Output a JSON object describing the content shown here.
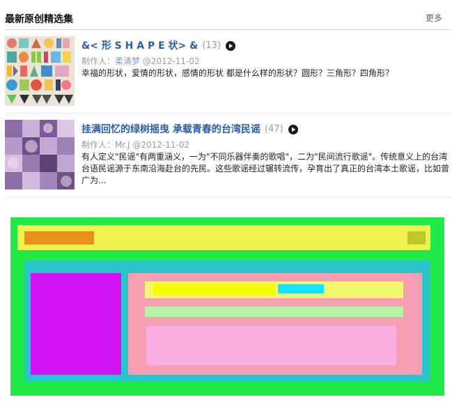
{
  "header": {
    "title": "最新原创精选集",
    "more_label": "更多"
  },
  "items": [
    {
      "title": "&< 形 S H A P E 状> &",
      "count": "(13)",
      "meta_prefix": "制作人：",
      "author": "柔清梦",
      "date": "@2012-11-02",
      "description": "幸福的形状，爱情的形状，感情的形状 都是什么样的形状？圆形？三角形？四角形？",
      "thumb": "alphabet-letters-image"
    },
    {
      "title": "挂满回忆的绿树摇曳 承载青春的台湾民谣",
      "count": "(47)",
      "meta_prefix": "制作人：",
      "author": "Mr.J",
      "date": "@2012-11-02",
      "description": "有人定义\"民谣\"有两重涵义，一为\"不同乐器伴奏的歌唱\"，二为\"民间流行歌谣\"。传统意义上的台湾台语民谣源于东南沿海赴台的先民。这些歌谣经过辗转流传，孕育出了真正的台湾本土歌谣，比如曾广为...",
      "thumb": "purple-collage-image"
    }
  ],
  "colors": {
    "link": "#2a5db0",
    "muted": "#9a9a9a",
    "author_link": "#7b9ccf",
    "sample_outer": "#22ea48",
    "sample_header": "#f0f14e",
    "sample_logo": "#e6911b",
    "sample_body": "#29c4cc",
    "sample_side": "#d112f2",
    "sample_main": "#f69db2"
  }
}
